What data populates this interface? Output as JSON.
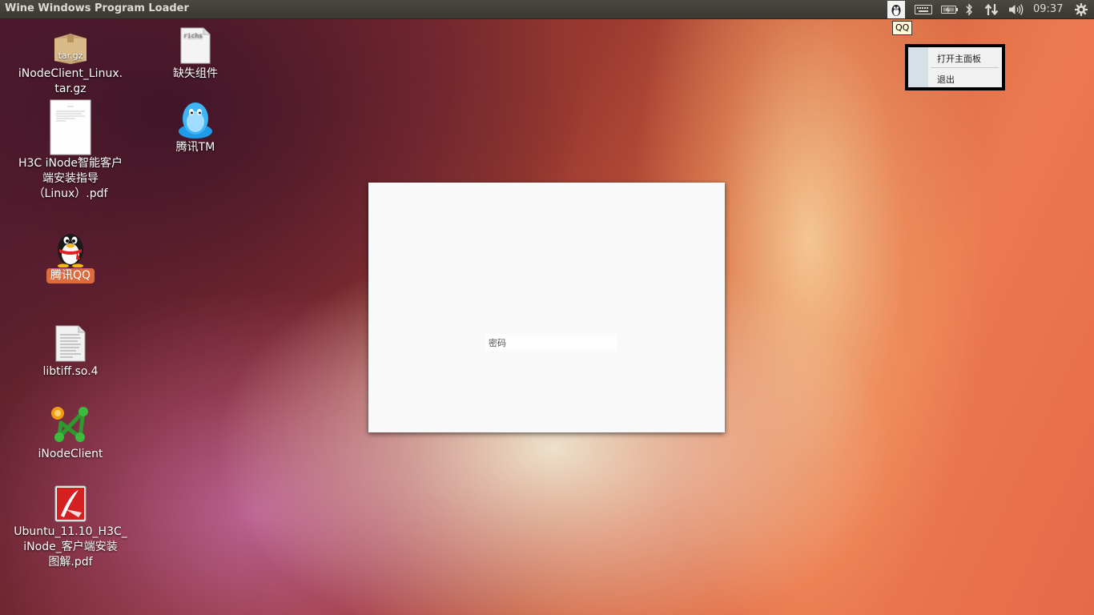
{
  "panel": {
    "app_title": "Wine Windows Program Loader",
    "clock": "09:37",
    "indicators": [
      "qq-tray-icon",
      "keyboard-icon",
      "battery-icon",
      "bluetooth-icon",
      "network-icon",
      "volume-icon",
      "session-gear-icon"
    ]
  },
  "tray": {
    "tooltip": "QQ",
    "menu": {
      "items": [
        "打开主面板",
        "退出"
      ]
    }
  },
  "desktop": {
    "icons": [
      {
        "label": "iNodeClient_Linux.\ntar.gz",
        "icon": "archive-icon",
        "badge": "tar.gz"
      },
      {
        "label": "缺失组件",
        "icon": "text-file-icon",
        "badge": "richs"
      },
      {
        "label": "H3C iNode智能客户\n端安装指导\n（Linux）.pdf",
        "icon": "pdf-document-icon"
      },
      {
        "label": "腾讯TM",
        "icon": "tm-penguin-icon"
      },
      {
        "label": "腾讯QQ",
        "icon": "qq-penguin-icon"
      },
      {
        "label": "libtiff.so.4",
        "icon": "library-file-icon"
      },
      {
        "label": "iNodeClient",
        "icon": "inode-client-icon"
      },
      {
        "label": "Ubuntu_11.10_H3C_\niNode_客户端安装\n图解.pdf",
        "icon": "pdf-reader-icon"
      }
    ]
  },
  "login_window": {
    "password_placeholder": "密码"
  },
  "colors": {
    "panel_bg": "#3c3b37",
    "selected_label_bg": "#dd6b3d",
    "tooltip_bg": "#fffbd8"
  }
}
